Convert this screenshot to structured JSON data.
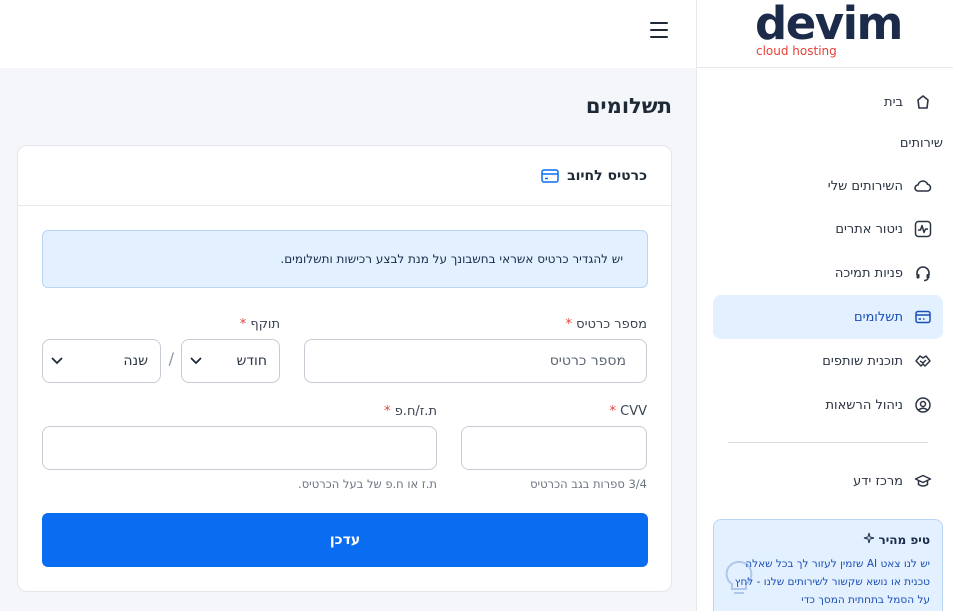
{
  "brand": {
    "name": "devim",
    "tagline": "cloud hosting",
    "name_color": "#1c2b4a",
    "tagline_color": "#e5413a"
  },
  "sidebar": {
    "items": [
      {
        "label": "בית",
        "icon": "home-icon"
      },
      {
        "label": "השירותים שלי",
        "icon": "cloud-icon"
      },
      {
        "label": "ניטור אתרים",
        "icon": "activity-icon"
      },
      {
        "label": "פניות תמיכה",
        "icon": "headset-icon"
      },
      {
        "label": "תשלומים",
        "icon": "payments-icon",
        "active": true
      },
      {
        "label": "תוכנית שותפים",
        "icon": "handshake-icon"
      },
      {
        "label": "ניהול הרשאות",
        "icon": "user-permissions-icon"
      },
      {
        "label": "מרכז ידע",
        "icon": "graduation-cap-icon"
      }
    ],
    "section_heading": "שירותים",
    "tip": {
      "title": "טיפ מהיר",
      "body": "יש לנו צאט AI שזמין לעזור לך בכל שאלה טכנית או נושא שקשור לשירותים שלנו - לחץ על הסמל בתחתית המסך כדי"
    }
  },
  "page": {
    "title": "תשלומים"
  },
  "card": {
    "title": "כרטיס לחיוב",
    "alert": "יש להגדיר כרטיס אשראי בחשבונך על מנת לבצע רכישות ותשלומים.",
    "card_number": {
      "label": "מספר כרטיס",
      "placeholder": "מספר כרטיס",
      "required_mark": "*"
    },
    "expiry": {
      "label": "תוקף",
      "required_mark": "*",
      "month_value": "חודש",
      "year_value": "שנה",
      "separator": "/"
    },
    "cvv": {
      "label": "CVV",
      "required_mark": "*",
      "value": "",
      "help": "3/4 ספרות בגב הכרטיס"
    },
    "id_number": {
      "label": "ת.ז/ח.פ",
      "required_mark": "*",
      "value": "",
      "help": "ת.ז או ח.פ של בעל הכרטיס."
    },
    "submit_label": "עדכן"
  },
  "colors": {
    "accent": "#0a6cf1",
    "active_bg": "#e3f0ff",
    "required": "#e5413a"
  }
}
